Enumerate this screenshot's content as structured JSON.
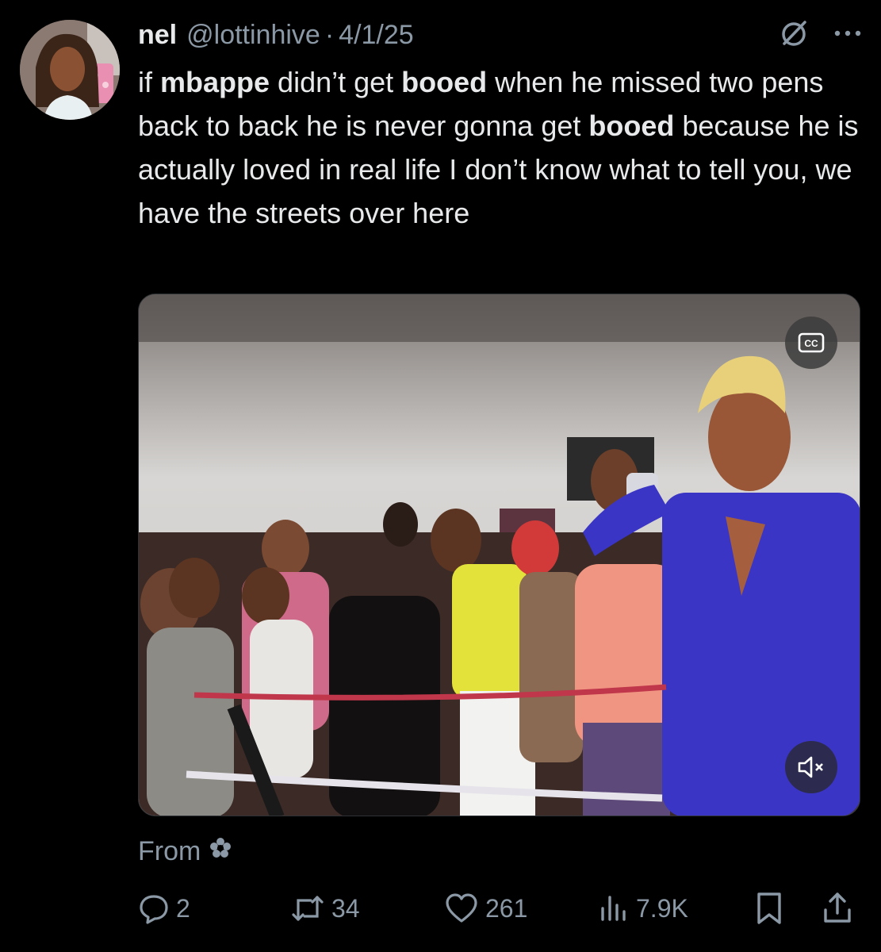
{
  "author": {
    "display_name": "nel",
    "handle": "@lottinhive",
    "separator": "·",
    "date": "4/1/25"
  },
  "tweet": {
    "segments": [
      {
        "text": "if ",
        "bold": false
      },
      {
        "text": "mbappe",
        "bold": true
      },
      {
        "text": " didn’t get ",
        "bold": false
      },
      {
        "text": "booed",
        "bold": true
      },
      {
        "text": " when he missed two pens back to back he is never gonna get ",
        "bold": false
      },
      {
        "text": "booed",
        "bold": true
      },
      {
        "text": " because he is actually loved in real life I don’t know what to tell you, we have the streets over here",
        "bold": false
      }
    ]
  },
  "media": {
    "cc_icon": "closed-captions-icon",
    "mute_icon": "speaker-muted-icon"
  },
  "from": {
    "label": "From",
    "icon": "flower-icon"
  },
  "actions": {
    "replies": "2",
    "reposts": "34",
    "likes": "261",
    "views": "7.9K"
  },
  "colors": {
    "background": "#000000",
    "text_primary": "#e7e9ea",
    "text_secondary": "#8b98a5"
  }
}
